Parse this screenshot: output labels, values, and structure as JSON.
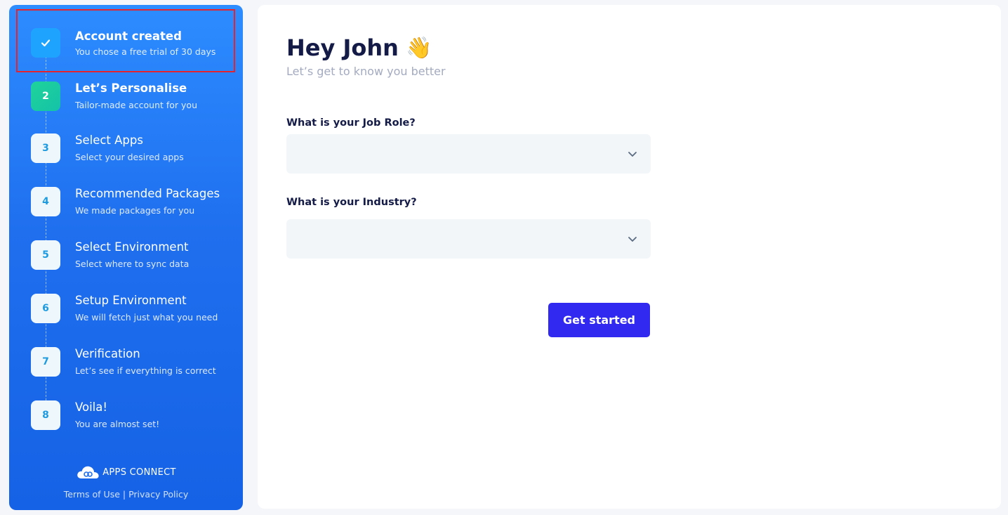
{
  "sidebar": {
    "steps": [
      {
        "badge": "",
        "title": "Account created",
        "subtitle": "You chose a free trial of 30 days",
        "state": "done"
      },
      {
        "badge": "2",
        "title": "Let’s Personalise",
        "subtitle": "Tailor-made account for you",
        "state": "active"
      },
      {
        "badge": "3",
        "title": "Select Apps",
        "subtitle": "Select your desired apps",
        "state": "pending"
      },
      {
        "badge": "4",
        "title": "Recommended Packages",
        "subtitle": "We made packages for you",
        "state": "pending"
      },
      {
        "badge": "5",
        "title": "Select Environment",
        "subtitle": "Select where to sync data",
        "state": "pending"
      },
      {
        "badge": "6",
        "title": "Setup Environment",
        "subtitle": "We will fetch just what you need",
        "state": "pending"
      },
      {
        "badge": "7",
        "title": "Verification",
        "subtitle": "Let’s see if everything is correct",
        "state": "pending"
      },
      {
        "badge": "8",
        "title": "Voila!",
        "subtitle": "You are almost set!",
        "state": "pending"
      }
    ],
    "brand": {
      "name": "APPS CONNECT"
    },
    "legal": {
      "terms": "Terms of Use",
      "separator": " | ",
      "privacy": "Privacy Policy"
    }
  },
  "main": {
    "greeting": "Hey John",
    "greeting_emoji": "👋",
    "subtitle": "Let’s get to know you better",
    "job_role": {
      "label": "What is your Job Role?",
      "value": ""
    },
    "industry": {
      "label": "What is your Industry?",
      "value": ""
    },
    "submit_label": "Get started"
  },
  "colors": {
    "sidebar_top": "#2d8cff",
    "sidebar_bottom": "#1662e6",
    "active_badge": "#1fd39a",
    "primary_button": "#3229f0",
    "heading": "#141b47",
    "highlight_border": "#e5232e"
  },
  "icons": {
    "done_step": "check-icon",
    "dropdown": "chevron-down-icon",
    "brand": "cloud-logo-icon"
  }
}
